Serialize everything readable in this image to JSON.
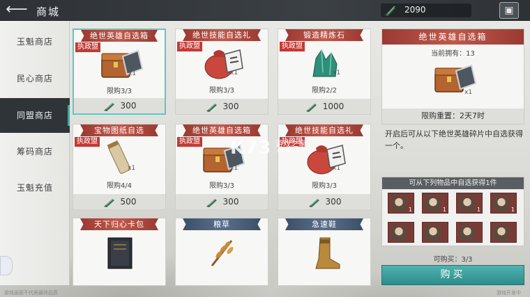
{
  "header": {
    "back_icon": "back-arrow-icon",
    "title": "商城",
    "currency_value": "2090",
    "currency_icon": "jade-token-icon",
    "gift_icon": "gift-icon"
  },
  "sidebar": {
    "items": [
      {
        "label": "玉魁商店",
        "active": false
      },
      {
        "label": "民心商店",
        "active": false
      },
      {
        "label": "同盟商店",
        "active": true
      },
      {
        "label": "筹码商店",
        "active": false
      },
      {
        "label": "玉魁充值",
        "active": false
      }
    ]
  },
  "cards": [
    {
      "title": "绝世英雄自选箱",
      "ribbon": "red",
      "tag": "执政盟",
      "qty": "x1",
      "limit": "限购3/3",
      "price": "300",
      "selected": true,
      "art": "chest"
    },
    {
      "title": "绝世技能自选礼",
      "ribbon": "red",
      "tag": "执政盟",
      "qty": "x1",
      "limit": "限购3/3",
      "price": "300",
      "selected": false,
      "art": "bag"
    },
    {
      "title": "锻造精炼石",
      "ribbon": "red",
      "tag": "执政盟",
      "qty": "x1",
      "limit": "限购2/2",
      "price": "1000",
      "selected": false,
      "art": "crystal"
    },
    {
      "title": "宝物图纸自选",
      "ribbon": "red",
      "tag": "执政盟",
      "qty": "x1",
      "limit": "限购4/4",
      "price": "500",
      "selected": false,
      "art": "scroll"
    },
    {
      "title": "绝世英雄自选箱",
      "ribbon": "red",
      "tag": "执政盟",
      "qty": "x1",
      "limit": "限购3/3",
      "price": "300",
      "selected": false,
      "art": "chest"
    },
    {
      "title": "绝世技能自选礼",
      "ribbon": "red",
      "tag": "执政盟",
      "qty": "x1",
      "limit": "限购3/3",
      "price": "300",
      "selected": false,
      "art": "bag"
    },
    {
      "title": "天下归心卡包",
      "ribbon": "red",
      "tag": "",
      "qty": "",
      "limit": "",
      "price": "",
      "selected": false,
      "art": "book"
    },
    {
      "title": "粮草",
      "ribbon": "blue",
      "tag": "",
      "qty": "",
      "limit": "",
      "price": "",
      "selected": false,
      "art": "wheat"
    },
    {
      "title": "急速鞋",
      "ribbon": "blue",
      "tag": "",
      "qty": "",
      "limit": "",
      "price": "",
      "selected": false,
      "art": "boot"
    }
  ],
  "detail": {
    "title": "绝世英雄自选箱",
    "owned": "当前拥有：13",
    "qty": "x1",
    "reset": "限购重置：2天7时",
    "description": "开启后可从以下绝世英雄碎片中自选获得一个。",
    "chooser_title": "可从下列物品中自选获得1件",
    "slot_counts": [
      "1",
      "1",
      "1",
      "1",
      "",
      "",
      "",
      ""
    ],
    "can_buy": "可购买：3/3",
    "buy_label": "购买"
  },
  "watermark": {
    "logo": "K73",
    "sub": "游戏之家",
    "url": ".com"
  },
  "footnote": "游戏画面不代表最终品质",
  "footnote_right": "游戏开发中"
}
